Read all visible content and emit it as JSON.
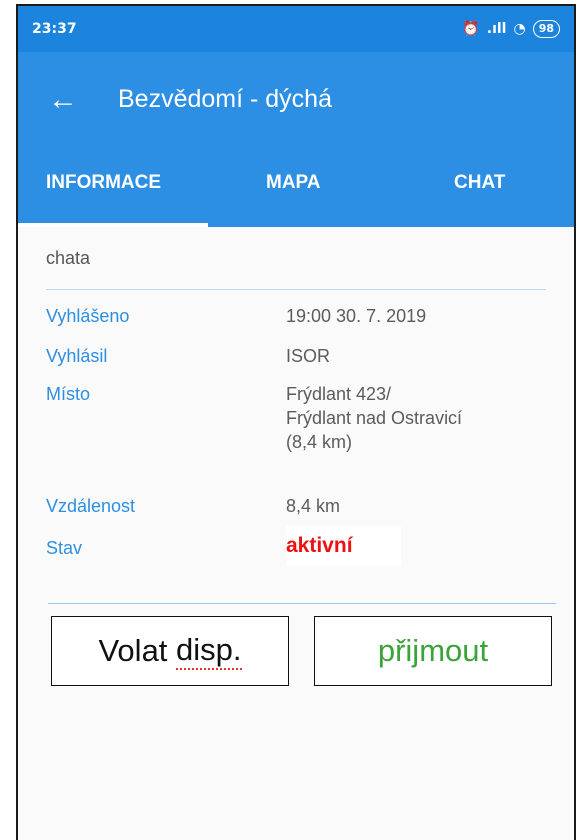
{
  "status_bar": {
    "time": "23:37",
    "battery": "98",
    "signal_glyph": ".ıll",
    "alarm_glyph": "⏰",
    "wifi_glyph": "◔"
  },
  "app_bar": {
    "back_glyph": "←",
    "title": "Bezvědomí - dýchá"
  },
  "tabs": [
    {
      "label": "INFORMACE",
      "active": true
    },
    {
      "label": "MAPA",
      "active": false
    },
    {
      "label": "CHAT",
      "active": false
    }
  ],
  "subtitle": "chata",
  "details": {
    "reported_label": "Vyhlášeno",
    "reported_value": "19:00 30. 7. 2019",
    "reporter_label": "Vyhlásil",
    "reporter_value": "ISOR",
    "place_label": "Místo",
    "place_line1": "Frýdlant 423/",
    "place_line2": "Frýdlant nad Ostravicí",
    "place_line3": "(8,4 km)",
    "distance_label": "Vzdálenost",
    "distance_value": "8,4 km",
    "status_label": "Stav",
    "status_value": "aktivní"
  },
  "buttons": {
    "call_label_a": "Volat ",
    "call_label_b": "disp.",
    "accept_label": "přijmout"
  },
  "colors": {
    "primary": "#2d8fe3",
    "status_bar": "#1c84dc",
    "status_active": "#ee1111",
    "accept": "#3aa33a"
  }
}
